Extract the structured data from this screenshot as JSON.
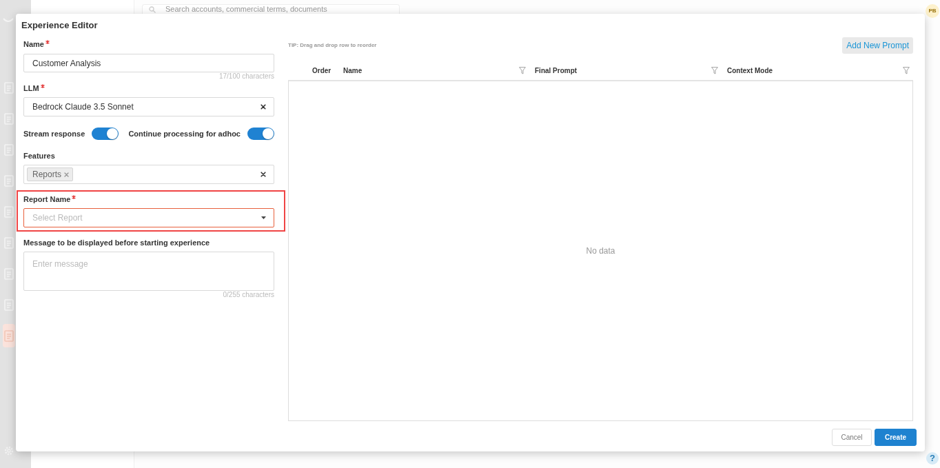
{
  "background": {
    "search_placeholder": "Search accounts, commercial terms, documents",
    "avatar": "PB",
    "help": "?",
    "sidebar": {
      "items": [
        {
          "selected": false
        },
        {
          "selected": false
        },
        {
          "selected": false
        },
        {
          "selected": false
        },
        {
          "selected": false
        },
        {
          "selected": false
        },
        {
          "selected": false
        },
        {
          "selected": false
        },
        {
          "selected": true
        }
      ]
    }
  },
  "dialog": {
    "title": "Experience Editor",
    "form": {
      "fields": [
        {
          "kind": "text",
          "label": "Name",
          "required": true,
          "value": "Customer Analysis",
          "counter": "17/100 characters",
          "invalid": false
        },
        {
          "kind": "select",
          "label": "LLM",
          "required": true,
          "value": "Bedrock Claude 3.5 Sonnet",
          "clearable": true,
          "invalid": false
        },
        {
          "kind": "toggles",
          "toggles": [
            {
              "label": "Stream response",
              "on": true
            },
            {
              "label": "Continue processing for adhoc",
              "on": true
            }
          ]
        },
        {
          "kind": "multiselect",
          "label": "Features",
          "tags": [
            "Reports"
          ],
          "clearable": true,
          "invalid": false
        },
        {
          "kind": "select",
          "label": "Report Name",
          "required": true,
          "placeholder": "Select Report",
          "clearable": false,
          "invalid": true,
          "highlighted": true
        },
        {
          "kind": "textarea",
          "label": "Message to be displayed before starting experience",
          "placeholder": "Enter message",
          "counter": "0/255 characters",
          "invalid": false
        }
      ]
    },
    "prompts": {
      "tip": "TIP: Drag and drop row to reorder",
      "add_button": "Add New Prompt",
      "columns": [
        {
          "label": "Order",
          "filterable": false
        },
        {
          "label": "Name",
          "filterable": true
        },
        {
          "label": "Final Prompt",
          "filterable": true
        },
        {
          "label": "Context Mode",
          "filterable": true
        }
      ],
      "empty_text": "No data"
    },
    "buttons": [
      {
        "label": "Cancel",
        "kind": "secondary"
      },
      {
        "label": "Create",
        "kind": "primary"
      }
    ]
  }
}
